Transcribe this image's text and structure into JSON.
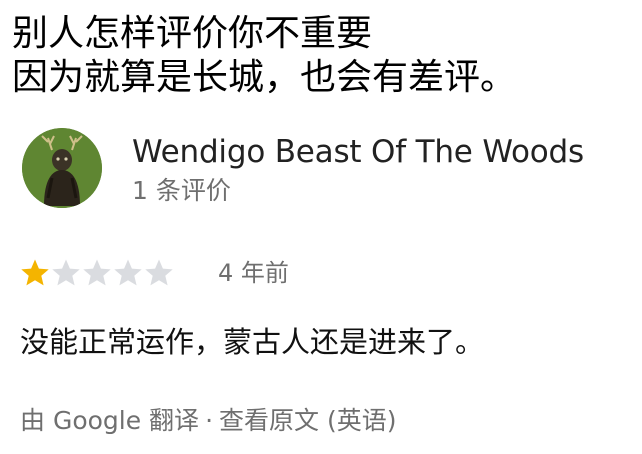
{
  "caption": {
    "line1": "别人怎样评价你不重要",
    "line2": "因为就算是长城，也会有差评。"
  },
  "reviewer": {
    "name": "Wendigo Beast Of The Woods",
    "review_count": "1 条评价",
    "avatar_icon": "wendigo-avatar-icon"
  },
  "review": {
    "rating": 1,
    "rating_max": 5,
    "star_filled_color": "#f4b400",
    "star_empty_color": "#dadce0",
    "age": "4 年前",
    "text": "没能正常运作，蒙古人还是进来了。"
  },
  "translation": {
    "label": "由 Google 翻译",
    "separator": "·",
    "view_original": "查看原文 (英语)"
  }
}
